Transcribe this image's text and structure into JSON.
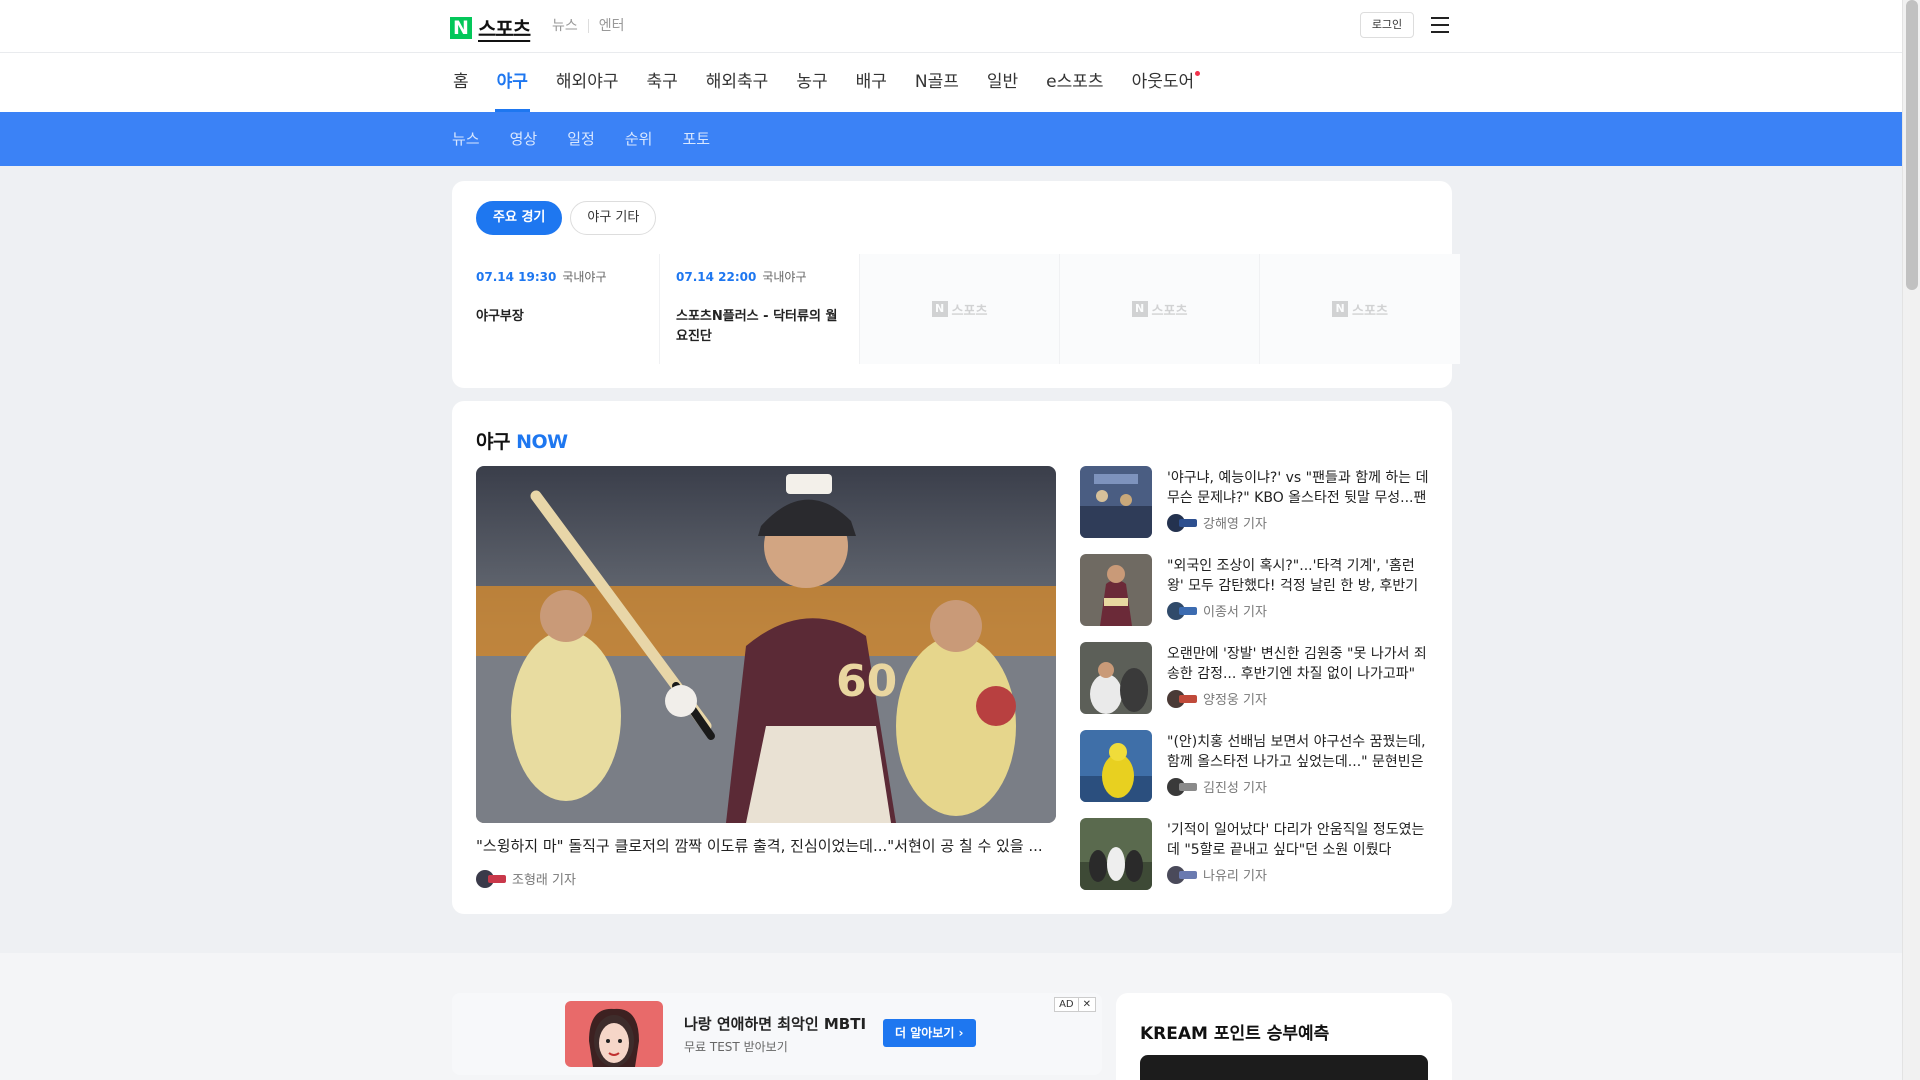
{
  "header": {
    "logo_letter": "N",
    "logo_text": "스포츠",
    "links": [
      "뉴스",
      "엔터"
    ],
    "login_label": "로그인",
    "menu_icon": "hamburger-menu-icon"
  },
  "catnav": {
    "items": [
      "홈",
      "야구",
      "해외야구",
      "축구",
      "해외축구",
      "농구",
      "배구",
      "N골프",
      "일반",
      "e스포츠",
      "아웃도어"
    ],
    "active": "야구"
  },
  "subnav": {
    "items": [
      "뉴스",
      "영상",
      "일정",
      "순위",
      "포토"
    ]
  },
  "games": {
    "tabs": [
      "주요 경기",
      "야구 기타"
    ],
    "active_tab": "주요 경기",
    "items": [
      {
        "time": "07.14 19:30",
        "category": "국내야구",
        "title": "야구부장"
      },
      {
        "time": "07.14 22:00",
        "category": "국내야구",
        "title": "스포츠N플러스 - 닥터류의 월요진단"
      }
    ],
    "placeholder_letter": "N",
    "placeholder_text": "스포츠"
  },
  "now": {
    "title_prefix": "야구",
    "title_accent": "NOW",
    "hero": {
      "caption": "\"스윙하지 마\" 돌직구 클로저의 깜짝 이도류 출격, 진심이었는데...\"서현이 공 칠 수 있을 ...",
      "reporter": "조형래 기자"
    },
    "articles": [
      {
        "title": "'야구냐, 예능이냐?' vs \"팬들과 함께 하는 데 무슨 문제냐?\" KBO 올스타전 뒷말 무성...팬들 '...",
        "reporter": "강해영 기자"
      },
      {
        "title": "\"외국인 조상이 혹시?\"...'타격 기계', '홈런왕' 모두 감탄했다! 걱정 날린 한 방, 후반기도 최고 ...",
        "reporter": "이종서 기자"
      },
      {
        "title": "오랜만에 '장발' 변신한 김원중 \"못 나가서 죄송한 감정... 후반기엔 차질 없이 나가고파\" [올...",
        "reporter": "양정웅 기자"
      },
      {
        "title": "\"(안)치홍 선배님 보면서 야구선수 꿈꿨는데, 함께 올스타전 나가고 싶었는데...\" 문현빈은 한...",
        "reporter": "김진성 기자"
      },
      {
        "title": "'기적이 일어났다' 다리가 안움직일 정도였는데 \"5할로 끝내고 싶다\"던 소원 이뤘다",
        "reporter": "나유리 기자"
      }
    ]
  },
  "ad": {
    "title": "나랑 연애하면 최악인 MBTI",
    "subtitle": "무료 TEST 받아보기",
    "button": "더 알아보기 ›",
    "badge": "AD",
    "close": "✕"
  },
  "kream": {
    "title": "KREAM 포인트 승부예측"
  },
  "colors": {
    "accent": "#1e77f0",
    "subnav_bg": "#3b82f6",
    "logo_green": "#03c75a",
    "new_dot": "#f0324b"
  }
}
